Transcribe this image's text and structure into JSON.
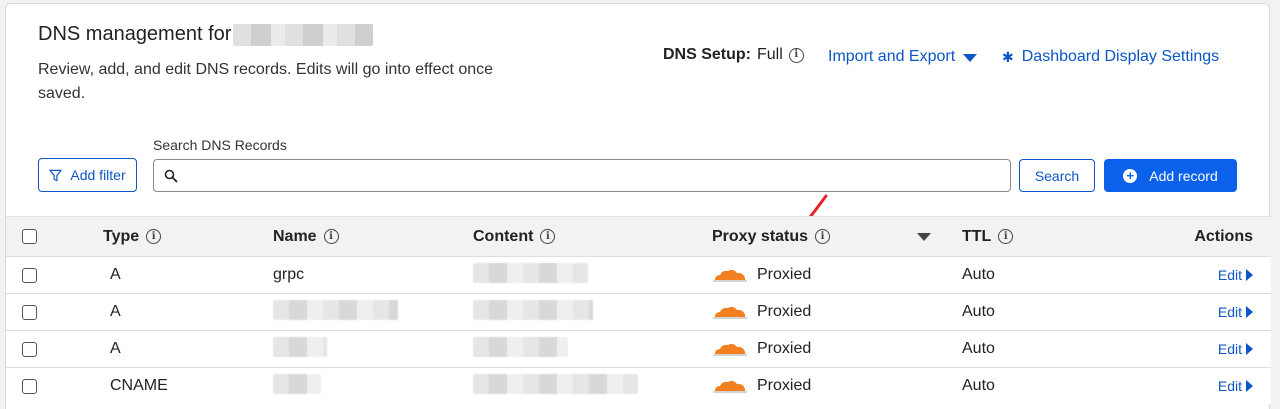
{
  "header": {
    "title_prefix": "DNS management for",
    "description": "Review, add, and edit DNS records. Edits will go into effect once saved.",
    "dns_setup_label": "DNS Setup:",
    "dns_setup_value": "Full",
    "import_export_label": "Import and Export",
    "display_settings_label": "Dashboard Display Settings"
  },
  "toolbar": {
    "add_filter_label": "Add filter",
    "search_label": "Search DNS Records",
    "search_value": "",
    "search_button_label": "Search",
    "add_record_label": "Add record"
  },
  "table": {
    "headers": {
      "type": "Type",
      "name": "Name",
      "content": "Content",
      "proxy_status": "Proxy status",
      "ttl": "TTL",
      "actions": "Actions"
    },
    "rows": [
      {
        "type": "A",
        "name": "grpc",
        "proxy_status": "Proxied",
        "ttl": "Auto",
        "action": "Edit"
      },
      {
        "type": "A",
        "name": "",
        "proxy_status": "Proxied",
        "ttl": "Auto",
        "action": "Edit"
      },
      {
        "type": "A",
        "name": "",
        "proxy_status": "Proxied",
        "ttl": "Auto",
        "action": "Edit"
      },
      {
        "type": "CNAME",
        "name": "",
        "proxy_status": "Proxied",
        "ttl": "Auto",
        "action": "Edit"
      }
    ]
  },
  "colors": {
    "link": "#0c56c6",
    "primary_button": "#0b61ea",
    "cloud_orange": "#f38020",
    "annotation_arrow": "#e8202a"
  },
  "icons": {
    "filter": "filter-icon",
    "search": "search-icon",
    "gear": "gear-icon",
    "info": "info-icon",
    "plus": "plus-circle-icon",
    "cloud": "cloud-icon",
    "edit_caret": "caret-right-icon"
  }
}
